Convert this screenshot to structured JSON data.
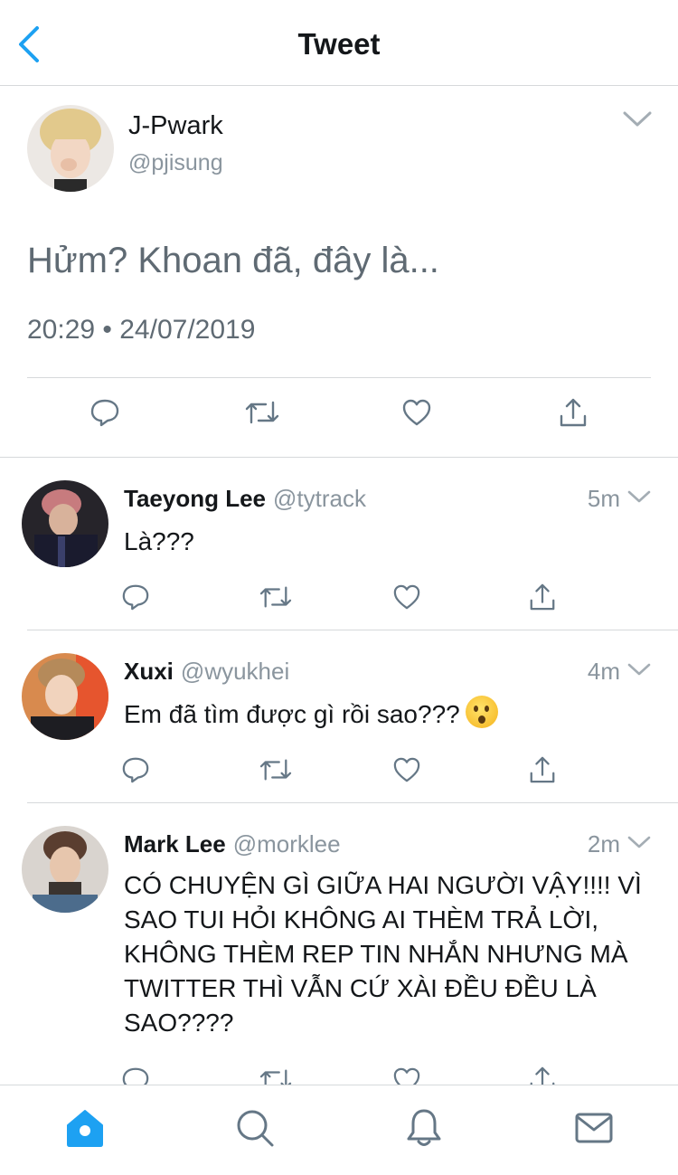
{
  "header": {
    "title": "Tweet",
    "back_icon": "chevron-left-icon"
  },
  "main_tweet": {
    "name": "J-Pwark",
    "handle": "@pjisung",
    "text": "Hửm? Khoan đã, đây là...",
    "meta": "20:29 • 24/07/2019",
    "actions": [
      "reply-icon",
      "retweet-icon",
      "like-icon",
      "share-icon"
    ]
  },
  "replies": [
    {
      "name": "Taeyong Lee",
      "handle": "@tytrack",
      "time": "5m",
      "text": "Là???"
    },
    {
      "name": "Xuxi",
      "handle": "@wyukhei",
      "time": "4m",
      "text": "Em đã tìm được gì rồi sao???"
    },
    {
      "name": "Mark Lee",
      "handle": "@morklee",
      "time": "2m",
      "text": "CÓ CHUYỆN GÌ GIỮA HAI NGƯỜI VẬY!!!! VÌ SAO TUI HỎI KHÔNG AI THÈM TRẢ LỜI, KHÔNG THÈM REP TIN NHẮN NHƯNG MÀ TWITTER THÌ VẪN CỨ XÀI ĐỀU ĐỀU LÀ SAO????"
    }
  ],
  "tabbar": {
    "tabs": [
      "home-icon",
      "search-icon",
      "notifications-icon",
      "messages-icon"
    ],
    "active": "home-icon"
  },
  "colors": {
    "accent": "#1da1f2",
    "icon_gray": "#657786",
    "text_gray": "#8a959e",
    "divider": "#d6d9db"
  }
}
